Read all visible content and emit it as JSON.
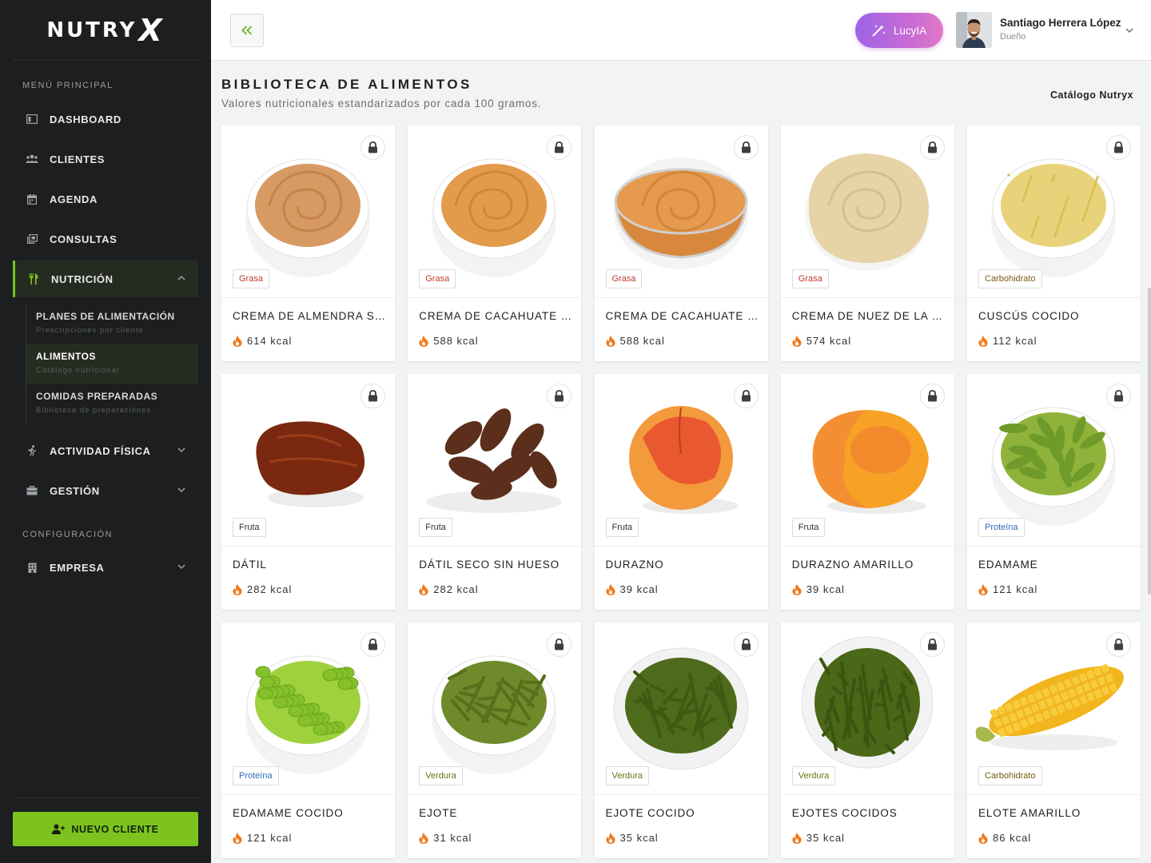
{
  "app": {
    "logo_text": "NUTRY",
    "logo_x": "X"
  },
  "sidebar": {
    "menu_title": "MENÚ PRINCIPAL",
    "items": [
      {
        "label": "DASHBOARD",
        "icon": "dashboard-icon"
      },
      {
        "label": "CLIENTES",
        "icon": "users-icon"
      },
      {
        "label": "AGENDA",
        "icon": "calendar-icon"
      },
      {
        "label": "CONSULTAS",
        "icon": "consultations-icon"
      },
      {
        "label": "NUTRICIÓN",
        "icon": "utensils-icon",
        "active": true,
        "expanded": true
      }
    ],
    "subitems": [
      {
        "title": "PLANES DE ALIMENTACIÓN",
        "subtitle": "Prescripciones por cliente"
      },
      {
        "title": "ALIMENTOS",
        "subtitle": "Catálogo nutricional",
        "active": true
      },
      {
        "title": "COMIDAS PREPARADAS",
        "subtitle": "Biblioteca de preparaciones"
      }
    ],
    "items2": [
      {
        "label": "ACTIVIDAD FÍSICA",
        "icon": "running-icon"
      },
      {
        "label": "GESTIÓN",
        "icon": "briefcase-icon"
      }
    ],
    "config_title": "CONFIGURACIÓN",
    "config_items": [
      {
        "label": "EMPRESA",
        "icon": "building-icon"
      }
    ],
    "new_client_label": "NUEVO CLIENTE",
    "accent": "#7cc31f"
  },
  "header": {
    "lucy_label": "LucyIA",
    "user_name": "Santiago Herrera López",
    "user_role": "Dueño"
  },
  "main": {
    "title": "BIBLIOTECA DE ALIMENTOS",
    "subtitle": "Valores nutricionales estandarizados por cada 100 gramos.",
    "catalog_label": "Catálogo Nutryx",
    "foods": [
      {
        "name": "CREMA DE ALMENDRA SI...",
        "kcal": "614 kcal",
        "category": "Grasa",
        "image": "almond-butter-bowl"
      },
      {
        "name": "CREMA DE CACAHUATE N...",
        "kcal": "588 kcal",
        "category": "Grasa",
        "image": "peanut-butter-bowl"
      },
      {
        "name": "CREMA DE CACAHUATE S...",
        "kcal": "588 kcal",
        "category": "Grasa",
        "image": "peanut-butter-glass-bowl"
      },
      {
        "name": "CREMA DE NUEZ DE LA IN...",
        "kcal": "574 kcal",
        "category": "Grasa",
        "image": "cashew-butter-swirl"
      },
      {
        "name": "CUSCÚS COCIDO",
        "kcal": "112 kcal",
        "category": "Carbohidrato",
        "image": "couscous-bowl"
      },
      {
        "name": "DÁTIL",
        "kcal": "282 kcal",
        "category": "Fruta",
        "image": "date-single"
      },
      {
        "name": "DÁTIL SECO SIN HUESO",
        "kcal": "282 kcal",
        "category": "Fruta",
        "image": "dates-pile"
      },
      {
        "name": "DURAZNO",
        "kcal": "39 kcal",
        "category": "Fruta",
        "image": "peach"
      },
      {
        "name": "DURAZNO AMARILLO",
        "kcal": "39 kcal",
        "category": "Fruta",
        "image": "yellow-peach-half"
      },
      {
        "name": "EDAMAME",
        "kcal": "121 kcal",
        "category": "Proteína",
        "image": "edamame-pods-bowl"
      },
      {
        "name": "EDAMAME COCIDO",
        "kcal": "121 kcal",
        "category": "Proteína",
        "image": "edamame-beans-bowl"
      },
      {
        "name": "EJOTE",
        "kcal": "31 kcal",
        "category": "Verdura",
        "image": "green-beans-bowl"
      },
      {
        "name": "EJOTE COCIDO",
        "kcal": "35 kcal",
        "category": "Verdura",
        "image": "cooked-green-beans-plate"
      },
      {
        "name": "EJOTES COCIDOS",
        "kcal": "35 kcal",
        "category": "Verdura",
        "image": "cooked-green-beans-bowl"
      },
      {
        "name": "ELOTE AMARILLO",
        "kcal": "86 kcal",
        "category": "Carbohidrato",
        "image": "corn-cob"
      }
    ]
  },
  "category_colors": {
    "Grasa": "#c0392b",
    "Carbohidrato": "#7a5a12",
    "Fruta": "#333333",
    "Proteína": "#2a6fb8",
    "Verdura": "#5a7a14"
  }
}
